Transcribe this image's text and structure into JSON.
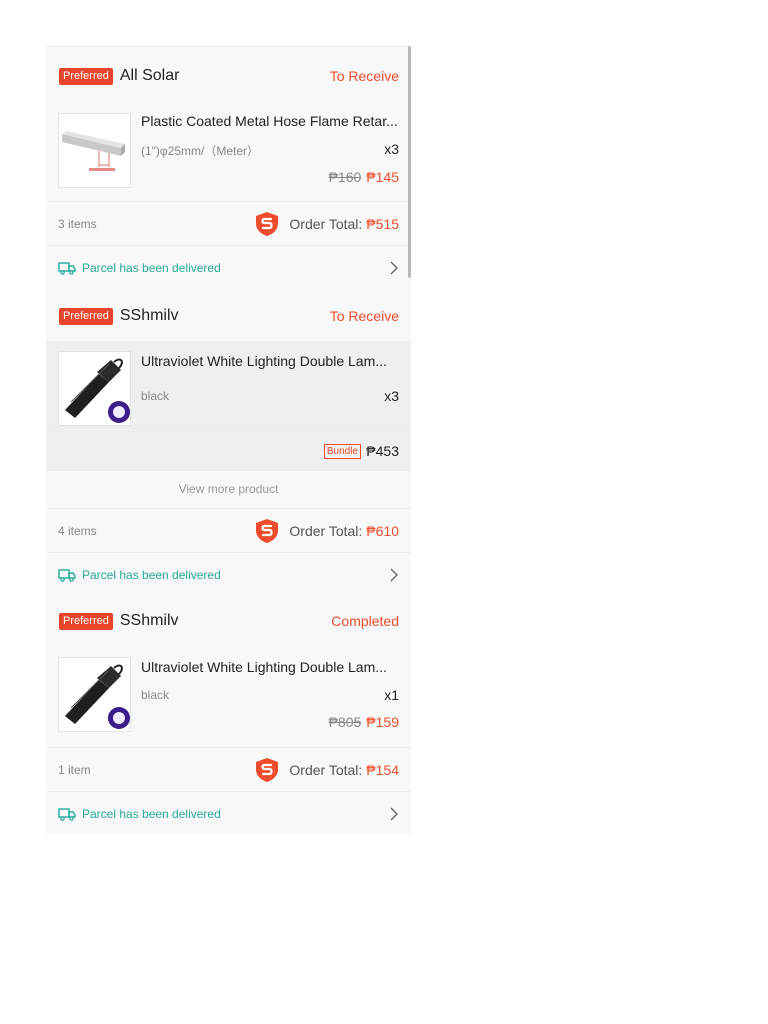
{
  "colors": {
    "accent": "#ee4d2d",
    "teal": "#26aa99",
    "badge": "#e8452c"
  },
  "orders": [
    {
      "badge": "Preferred",
      "shop": "All Solar",
      "status": "To Receive",
      "product": {
        "name": "Plastic Coated Metal Hose Flame Retar...",
        "variation": "(1\")φ25mm/（Meter）",
        "qty": "x3",
        "old_price": "₱160",
        "price": "₱145"
      },
      "items_count": "3 items",
      "total_label": "Order Total:",
      "total": "₱515",
      "parcel": "Parcel has been delivered"
    },
    {
      "badge": "Preferred",
      "shop": "SShmilv",
      "status": "To Receive",
      "product": {
        "name": "Ultraviolet White Lighting  Double Lam...",
        "variation": "black",
        "qty": "x3"
      },
      "bundle_label": "Bundle",
      "bundle_price": "₱453",
      "view_more": "View more product",
      "items_count": "4 items",
      "total_label": "Order Total:",
      "total": "₱610",
      "parcel": "Parcel has been delivered"
    },
    {
      "badge": "Preferred",
      "shop": "SShmilv",
      "status": "Completed",
      "product": {
        "name": "Ultraviolet White Lighting  Double Lam...",
        "variation": "black",
        "qty": "x1",
        "old_price": "₱805",
        "price": "₱159"
      },
      "items_count": "1 item",
      "total_label": "Order Total:",
      "total": "₱154",
      "parcel": "Parcel has been delivered"
    }
  ]
}
